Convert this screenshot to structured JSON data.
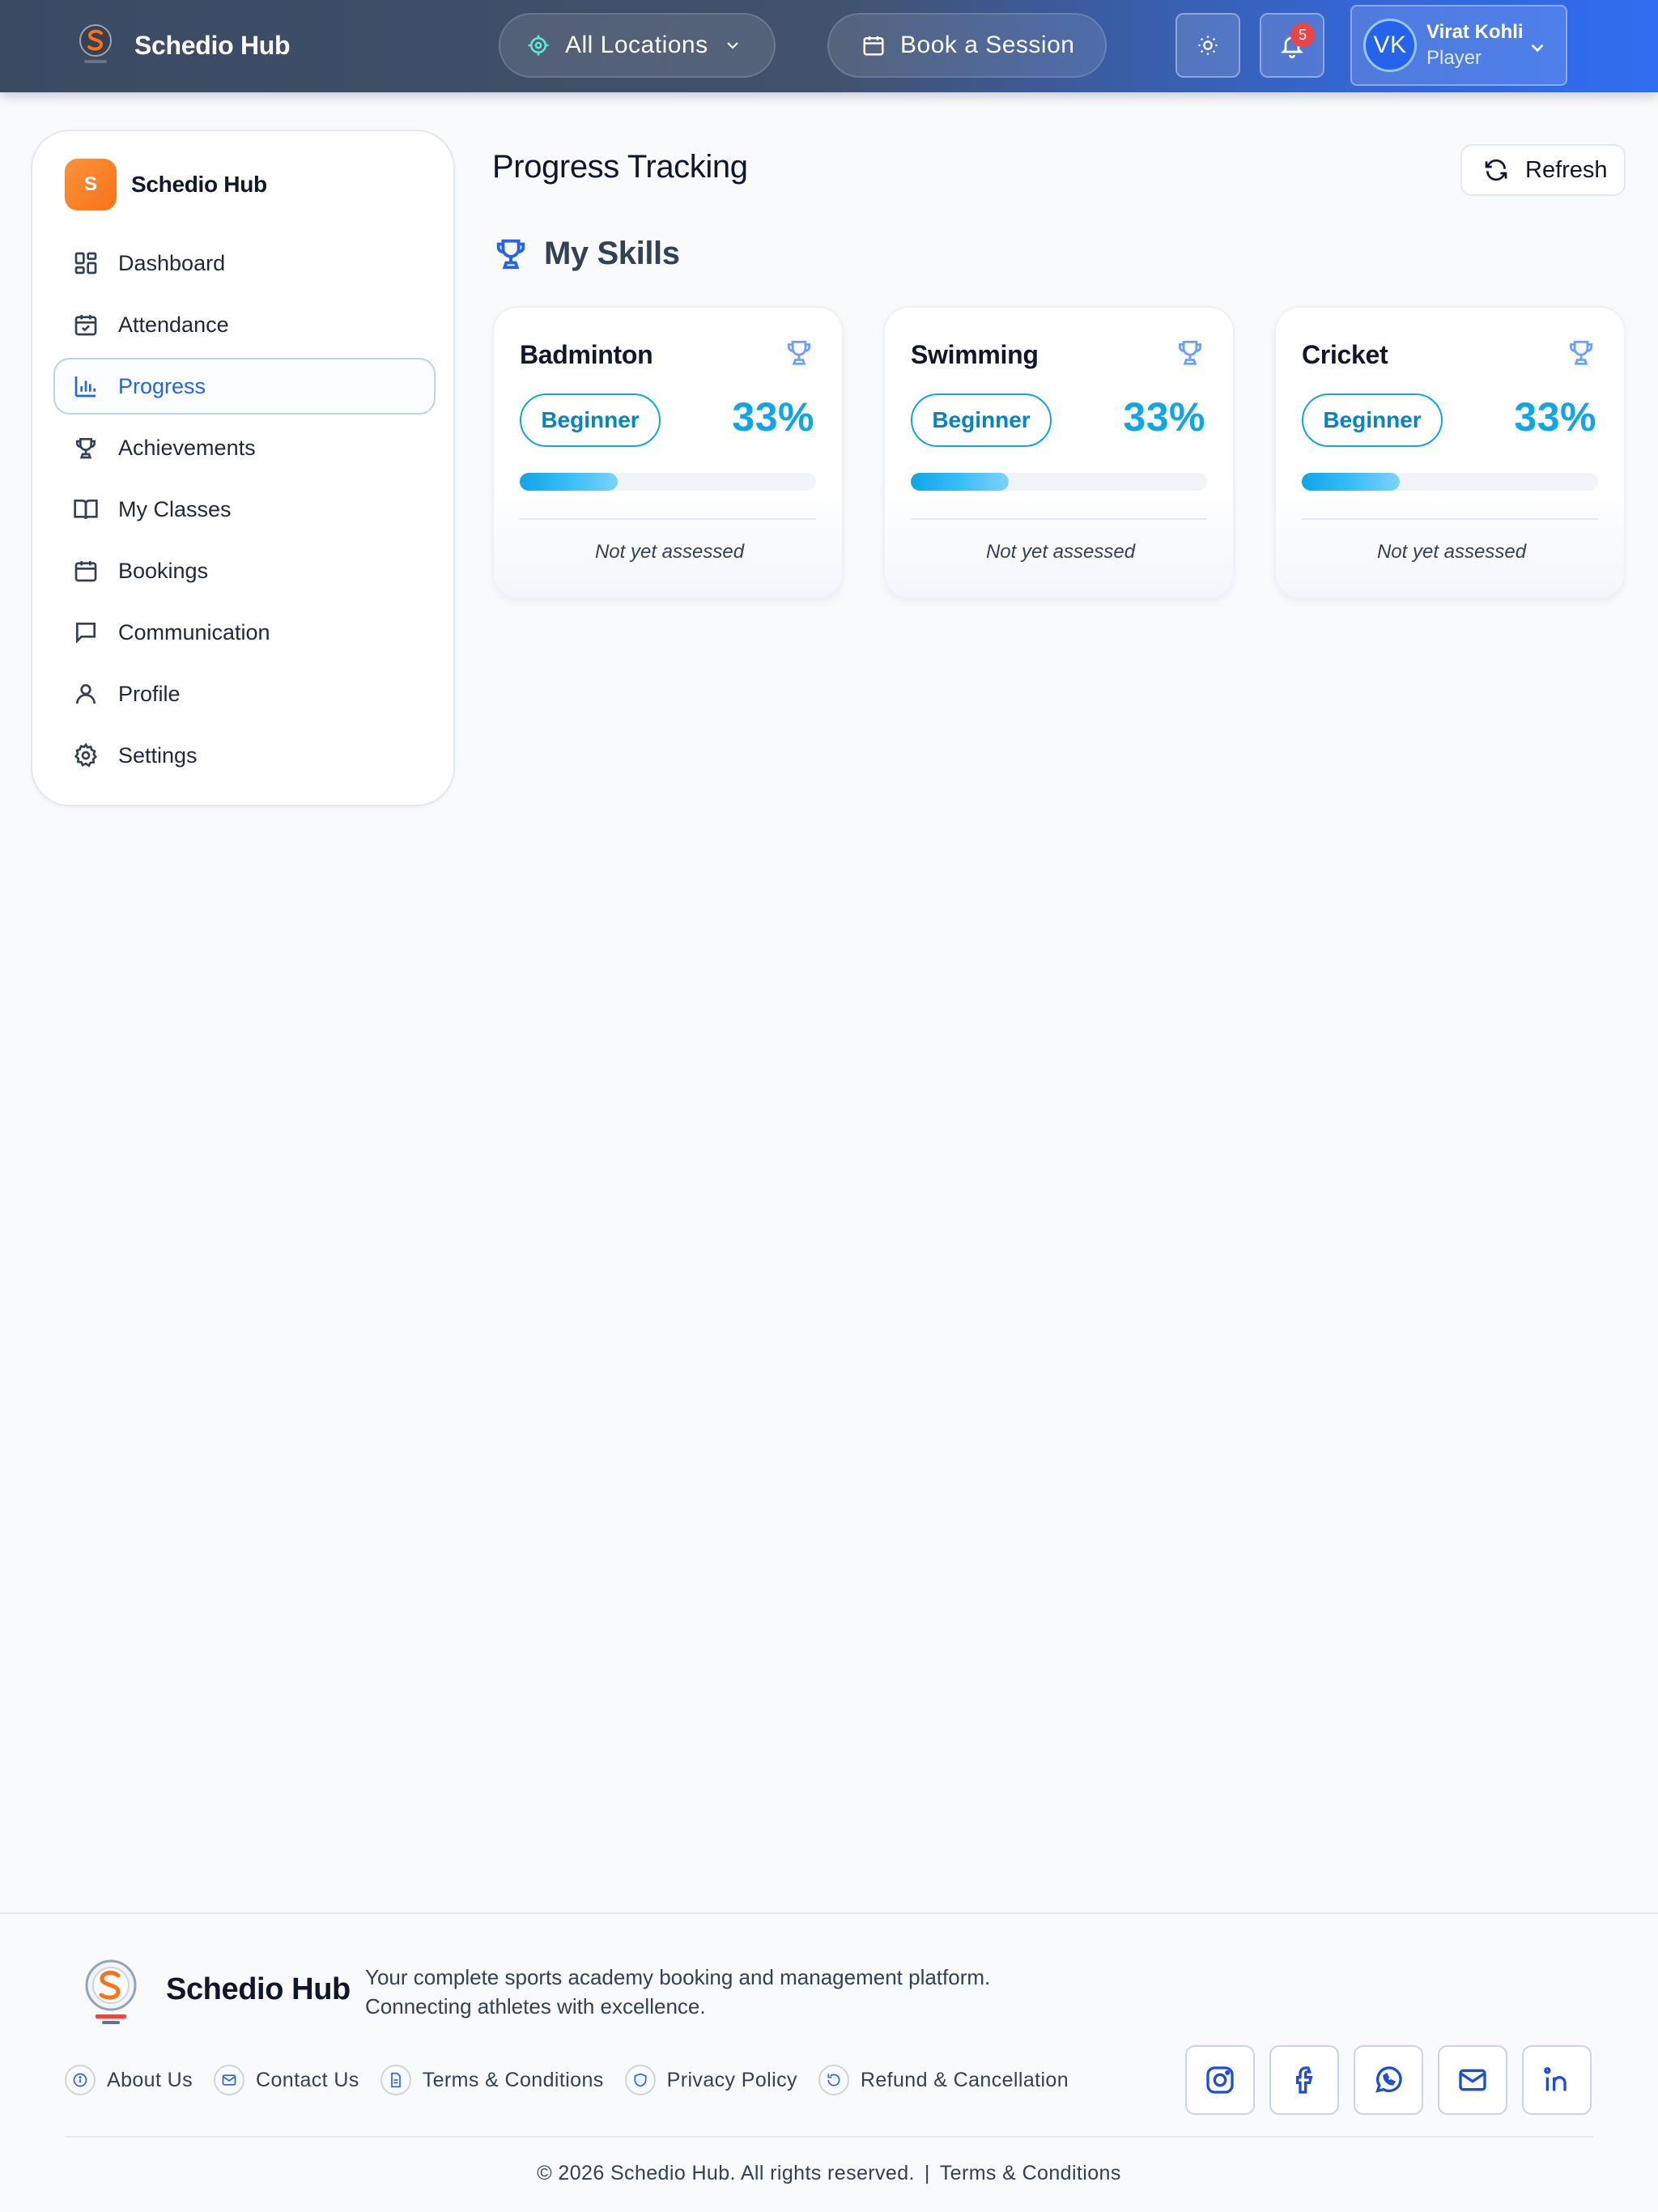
{
  "header": {
    "brand_name": "Schedio Hub",
    "location_label": "All Locations",
    "book_label": "Book a Session",
    "notification_count": "5",
    "user": {
      "initials": "VK",
      "name": "Virat Kohli",
      "role": "Player"
    }
  },
  "sidebar": {
    "brand_initial": "S",
    "brand_name": "Schedio Hub",
    "items": [
      {
        "label": "Dashboard",
        "icon": "dashboard-icon"
      },
      {
        "label": "Attendance",
        "icon": "calendar-check-icon"
      },
      {
        "label": "Progress",
        "icon": "bar-chart-icon",
        "active": true
      },
      {
        "label": "Achievements",
        "icon": "trophy-icon"
      },
      {
        "label": "My Classes",
        "icon": "book-open-icon"
      },
      {
        "label": "Bookings",
        "icon": "calendar-icon"
      },
      {
        "label": "Communication",
        "icon": "message-icon"
      },
      {
        "label": "Profile",
        "icon": "user-icon"
      },
      {
        "label": "Settings",
        "icon": "gear-icon"
      }
    ]
  },
  "main": {
    "title": "Progress Tracking",
    "refresh_label": "Refresh",
    "section_title": "My Skills",
    "skills": [
      {
        "name": "Badminton",
        "level": "Beginner",
        "percent_label": "33%",
        "progress": 0.33,
        "note": "Not yet assessed"
      },
      {
        "name": "Swimming",
        "level": "Beginner",
        "percent_label": "33%",
        "progress": 0.33,
        "note": "Not yet assessed"
      },
      {
        "name": "Cricket",
        "level": "Beginner",
        "percent_label": "33%",
        "progress": 0.33,
        "note": "Not yet assessed"
      }
    ]
  },
  "footer": {
    "brand_name": "Schedio Hub",
    "tagline_line1": "Your complete sports academy booking and management platform.",
    "tagline_line2": "Connecting athletes with excellence.",
    "links": [
      {
        "label": "About Us",
        "icon": "info-icon"
      },
      {
        "label": "Contact Us",
        "icon": "mail-icon"
      },
      {
        "label": "Terms & Conditions",
        "icon": "document-icon"
      },
      {
        "label": "Privacy Policy",
        "icon": "shield-icon"
      },
      {
        "label": "Refund & Cancellation",
        "icon": "refund-icon"
      }
    ],
    "social": [
      "instagram-icon",
      "facebook-icon",
      "whatsapp-icon",
      "email-icon",
      "linkedin-icon"
    ],
    "copyright": "© 2026 Schedio Hub. All rights reserved.",
    "separator": "|",
    "terms_link": "Terms & Conditions"
  },
  "colors": {
    "accent": "#2563eb",
    "progress": "#0ea5e9",
    "brand_orange": "#f97316",
    "badge": "#ef4444"
  }
}
